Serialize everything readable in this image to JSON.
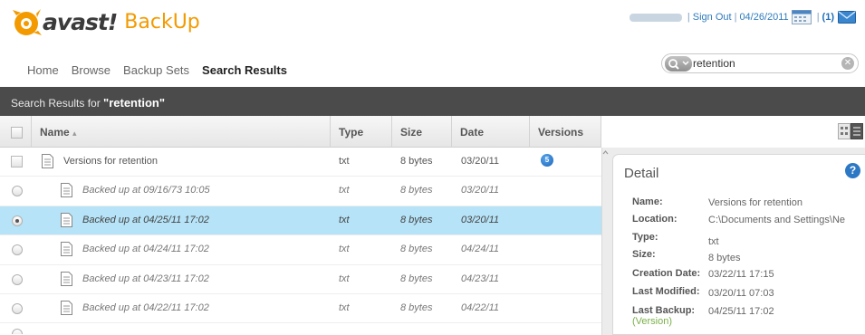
{
  "app": {
    "brand": "avast!",
    "product": "BackUp"
  },
  "topbar": {
    "sign_out": "Sign Out",
    "date": "04/26/2011",
    "messages": "(1)"
  },
  "nav": {
    "items": [
      "Home",
      "Browse",
      "Backup Sets",
      "Search Results"
    ],
    "active": "Search Results"
  },
  "search": {
    "value": "retention"
  },
  "results_bar": {
    "prefix": "Search Results for ",
    "query": "\"retention\""
  },
  "table": {
    "columns": {
      "name": "Name",
      "sort": "▴",
      "type": "Type",
      "size": "Size",
      "date": "Date",
      "versions": "Versions"
    },
    "rows": [
      {
        "name": "Versions for retention",
        "type": "txt",
        "size": "8 bytes",
        "date": "03/20/11",
        "versions": "5",
        "kind": "file"
      },
      {
        "name": "Backed up at 09/16/73 10:05",
        "type": "txt",
        "size": "8 bytes",
        "date": "03/20/11",
        "kind": "version"
      },
      {
        "name": "Backed up at 04/25/11 17:02",
        "type": "txt",
        "size": "8 bytes",
        "date": "03/20/11",
        "kind": "version",
        "selected": true
      },
      {
        "name": "Backed up at 04/24/11 17:02",
        "type": "txt",
        "size": "8 bytes",
        "date": "04/24/11",
        "kind": "version"
      },
      {
        "name": "Backed up at 04/23/11 17:02",
        "type": "txt",
        "size": "8 bytes",
        "date": "04/23/11",
        "kind": "version"
      },
      {
        "name": "Backed up at 04/22/11 17:02",
        "type": "txt",
        "size": "8 bytes",
        "date": "04/22/11",
        "kind": "version"
      }
    ]
  },
  "detail": {
    "title": "Detail",
    "help": "?",
    "labels": {
      "name": "Name:",
      "location": "Location:",
      "type": "Type:",
      "size": "Size:",
      "created": "Creation Date:",
      "modified": "Last Modified:",
      "backup": "Last Backup:"
    },
    "values": {
      "name": "Versions for retention",
      "location": "C:\\Documents and Settings\\Ne",
      "type": "txt",
      "size": "8 bytes",
      "created": "03/22/11 17:15",
      "modified": "03/20/11 07:03",
      "backup": "04/25/11 17:02"
    },
    "version_link": "(Version)"
  },
  "colors": {
    "accent_orange": "#f39a00",
    "selection": "#b6e3f7",
    "bar": "#4b4b4b",
    "link": "#2f7bbd"
  }
}
